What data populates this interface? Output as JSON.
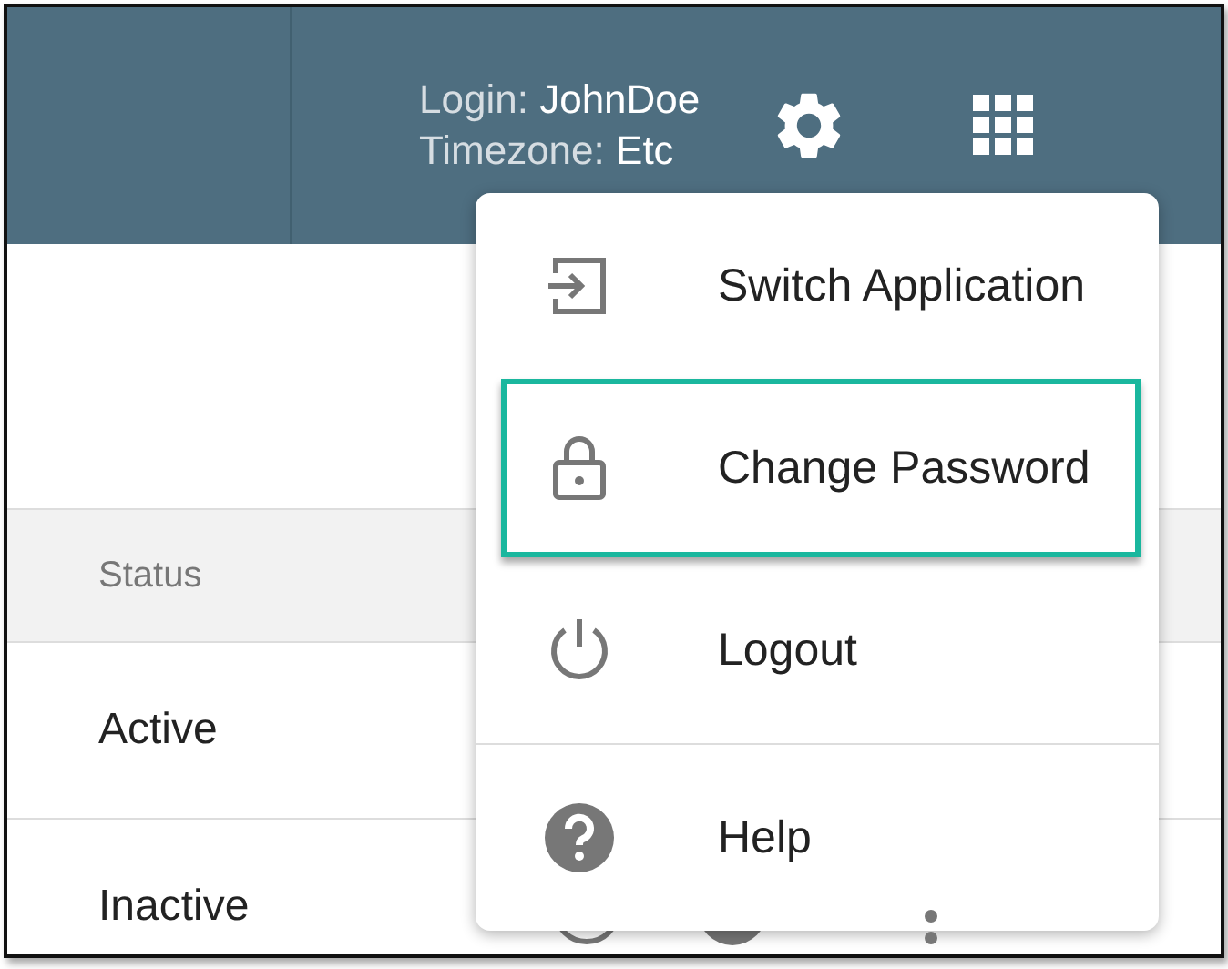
{
  "header": {
    "login_label": "Login:",
    "login_value": "JohnDoe",
    "timezone_label": "Timezone:",
    "timezone_value": "Etc"
  },
  "table": {
    "columns": [
      "Status"
    ],
    "rows": [
      {
        "status": "Active"
      },
      {
        "status": "Inactive"
      }
    ]
  },
  "menu": {
    "groups": [
      [
        {
          "kind": "switch",
          "label": "Switch Application",
          "selected": false
        },
        {
          "kind": "lock",
          "label": "Change Password",
          "selected": true
        },
        {
          "kind": "power",
          "label": "Logout",
          "selected": false
        }
      ],
      [
        {
          "kind": "help",
          "label": "Help",
          "selected": false
        }
      ]
    ]
  }
}
